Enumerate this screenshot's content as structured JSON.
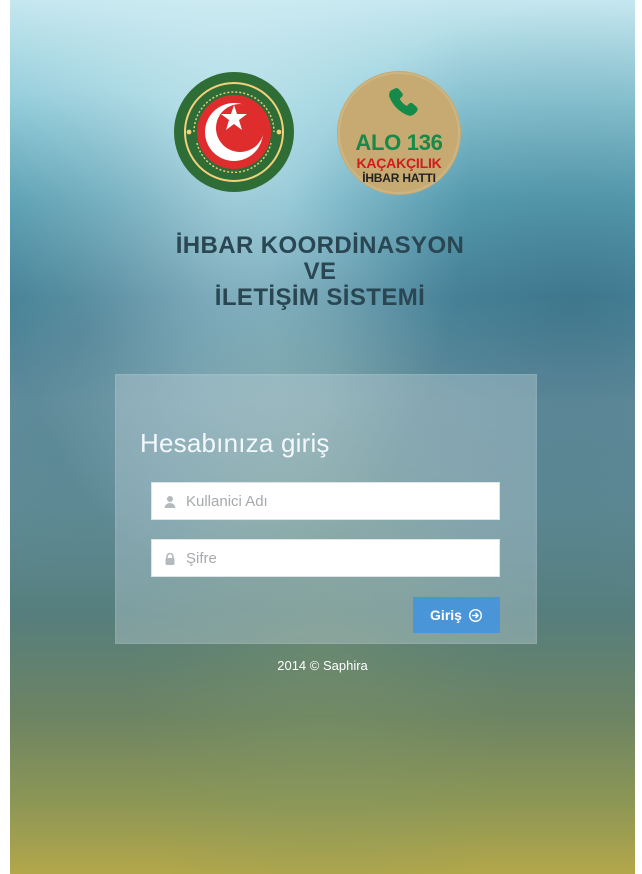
{
  "header": {
    "customs_logo_text": "GÜMRÜKLER MUHAFAZA CUSTOMS ENFORCEMENT",
    "hotline_number": "ALO 136",
    "hotline_line1": "KAÇAKÇILIK",
    "hotline_line2": "İHBAR HATTI"
  },
  "title": {
    "line1": "İHBAR KOORDİNASYON",
    "line2": "VE",
    "line3": "İLETİŞİM SİSTEMİ"
  },
  "login": {
    "heading": "Hesabınıza giriş",
    "username_placeholder": "Kullanici Adı",
    "password_placeholder": "Şifre",
    "button_label": "Giriş"
  },
  "footer": {
    "text": "2014 © Saphira"
  },
  "icons": {
    "user": "user-icon",
    "lock": "lock-icon",
    "submit": "arrow-circle-right-icon",
    "phone": "phone-icon"
  },
  "colors": {
    "title": "#294652",
    "button": "#4a95d8",
    "hotline_green": "#168a48",
    "hotline_red": "#d11c1c",
    "hotline_bg": "#c6aa72",
    "customs_green": "#2f6d37",
    "customs_red": "#df2d2d"
  }
}
